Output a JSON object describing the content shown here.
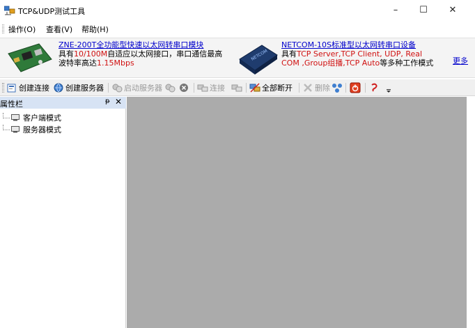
{
  "window": {
    "title": "TCP&UDP测试工具",
    "minimize": "–",
    "maximize": "☐",
    "close": "✕"
  },
  "menu": {
    "items": [
      "操作(O)",
      "查看(V)",
      "帮助(H)"
    ]
  },
  "banner": {
    "ad1": {
      "title": "ZNE-200T全功能型快速以太网转串口模块",
      "line2_prefix": "具有",
      "line2_red": "10/100M",
      "line2_suffix": "自适应以太网接口，串口通信最高",
      "line3_prefix": "波特率高达",
      "line3_red": "1.15Mbps"
    },
    "ad2": {
      "title": "NETCOM-10S标准型以太网转串口设备",
      "line2_prefix": "具有",
      "line2_red": "TCP Server,TCP Client, UDP, Real",
      "line3_red": "COM ,Group组播,TCP Auto",
      "line3_suffix": "等多种工作模式"
    },
    "more": "更多"
  },
  "toolbar": {
    "create_connection": "创建连接",
    "create_server": "创建服务器",
    "start_server": "启动服务器",
    "connect": "连接",
    "disconnect_all": "全部断开",
    "delete": "删除"
  },
  "pane": {
    "title": "属性栏",
    "pin": "ᵽ",
    "close": "✕",
    "items": [
      "客户端模式",
      "服务器模式"
    ]
  },
  "colors": {
    "pane_header": "#d7e3f4",
    "mdi_background": "#ababab",
    "link_blue": "#0000cc",
    "ad_red": "#d01010"
  }
}
